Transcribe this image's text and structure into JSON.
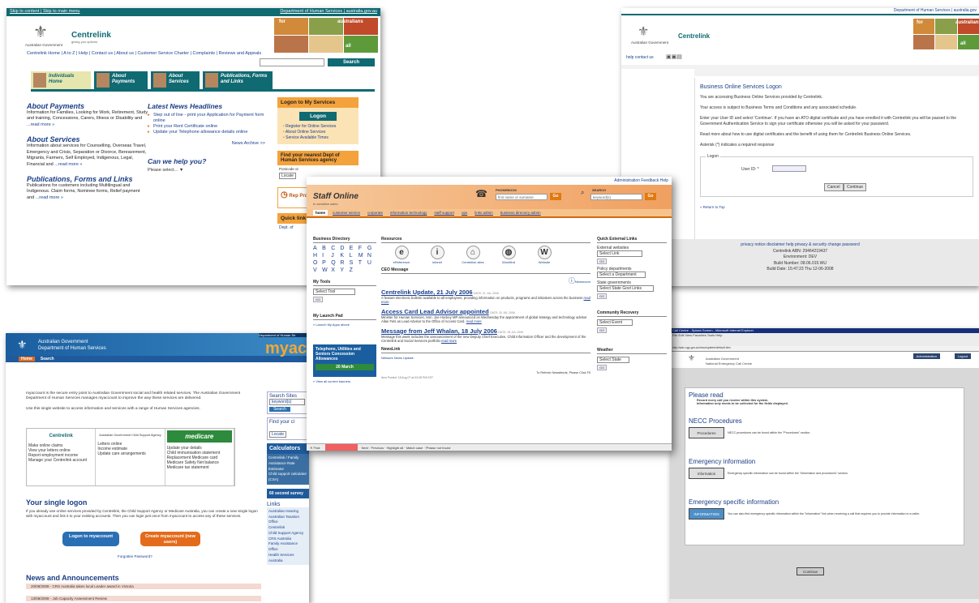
{
  "centrelink_home": {
    "topbar": {
      "skip_content": "Skip to content",
      "skip_menu": "Skip to main menu",
      "dhs": "Department of Human Services",
      "gov_url": "australia.gov.au"
    },
    "brand": {
      "gov": "Australian Government",
      "name": "Centrelink",
      "tag": "giving you options"
    },
    "photo": {
      "label": "australians",
      "for": "for",
      "all": "all"
    },
    "nav_links": "Centrelink Home | A to Z | Help | Contact us | About us | Customer Service Charter | Complaints | Reviews and Appeals",
    "search_button": "Search",
    "tabs": [
      {
        "label": "Individuals Home"
      },
      {
        "label": "About Payments"
      },
      {
        "label": "About Services"
      },
      {
        "label": "Publications, Forms and Links"
      }
    ],
    "about_payments": {
      "title": "About Payments",
      "body": "Information for Families, Looking for Work, Retirement, Study and training, Concessions, Carers, Illness or Disability and",
      "more": "...read more »"
    },
    "about_services": {
      "title": "About Services",
      "body": "Information about services for Counselling, Overseas Travel, Emergency and Crisis, Separation or Divorce, Bereavement, Migrants, Farmers, Self Employed, Indigenous, Legal, Financial and",
      "more": "...read more »"
    },
    "publications": {
      "title": "Publications, Forms and Links",
      "body": "Publications for customers including Multilingual and Indigenous. Claim forms, Nominee forms, Relief payment and",
      "more": "...read more »"
    },
    "news": {
      "title": "Latest News Headlines",
      "items": [
        "Step out of line - print your Application for Payment form online",
        "Print your Rent Certificate online",
        "Update your Telephone allowance details online"
      ],
      "archive": "News Archive >>"
    },
    "help": {
      "title": "Can we help you?",
      "select": "Please select... ▼"
    },
    "logon": {
      "title": "Logon to My Services",
      "button": "Logon",
      "links": [
        "Register for Online Services",
        "About Online Services",
        "Service Available Times"
      ]
    },
    "find": {
      "title": "Find your nearest Dept of Human Services agency",
      "postcode": "Postcode or",
      "locate": "Locate"
    },
    "rep": {
      "text": "Rep Pro"
    },
    "quick": {
      "title": "Quick link",
      "item": "Dept. of"
    }
  },
  "bos_logon": {
    "top_links": "Department of Human Services | australia.gov",
    "brand": {
      "gov": "Australian Government",
      "name": "Centrelink"
    },
    "photo": {
      "for": "for",
      "label": "australians",
      "all": "all"
    },
    "subnav": "help  contact us",
    "title": "Business Online Services Logon",
    "p1": "You are accessing Business Online Services provided by Centrelink.",
    "p2": "Your access is subject to Business Terms and Conditions and any associated schedule.",
    "p3": "Enter your User ID and select 'Continue'. If you have an ATO digital certificate and you have enrolled it with Centrelink you will be passed to the Government Authentication Service to sign your certificate otherwise you will be asked for your password.",
    "p4": "Read more about how to use digital certificates and the benefit of using them for Centrelink Business Online Services.",
    "p5": "Asterisk (*) indicates a required response",
    "legend": "Logon",
    "user_label": "User ID: *",
    "cancel": "Cancel",
    "continue": "Continue",
    "return": "» Return to Top",
    "footer_links": "privacy notice   disclaimer   help   privacy & security   change password",
    "abn": "Centrelink ABN: 29464219437",
    "env": "Environment: DEV",
    "build_num": "Build Number: 08.06.015.WU",
    "build_date": "Build Date: 15:47:23 Thu 12-06-2008"
  },
  "myaccount": {
    "strip": "Department of Human Se",
    "gov1": "Australian Government",
    "gov2": "Department of Human Services",
    "brand": "myac",
    "nav": [
      "Home",
      "Search"
    ],
    "intro1": "myaccount is the secure entry point to Australian Government social and health related services. The Australian Government Department of Human Services manages myaccount to improve the way these services are delivered.",
    "intro2": "Use this single website to access information and services with a range of Human Services agencies.",
    "cols": [
      {
        "logo": "Centrelink",
        "items": [
          "Make online claims",
          "View your letters online",
          "Report employment income",
          "Manage your Centrelink account"
        ]
      },
      {
        "logo": "Australian Government Child Support Agency",
        "items": [
          "Letters online",
          "Income estimate",
          "Update care arrangements"
        ]
      },
      {
        "logo": "medicare",
        "items": [
          "Update your details",
          "Child immunisation statement",
          "Replacement Medicare card",
          "Medicare Safety Net balance",
          "Medicare tax statement"
        ]
      }
    ],
    "single_title": "Your single logon",
    "single_body": "If you already use online services provided by Centrelink, the Child Support Agency or Medicare Australia, you can create a new single logon with myaccount and link it to your existing accounts. Then you can login just once from myaccount to access any of these services.",
    "login_btn": "Logon to myaccount",
    "create_btn": "Create myaccount (new users)",
    "forgot": "Forgotten Password?",
    "news_title": "News and Announcements",
    "news": [
      "20/08/2008 - CRS Australia takes local Leader award in Victoria",
      "13/08/2008 - Job Capacity Assessment Review"
    ],
    "search_sites": "Search Sites",
    "keywords": "keyword(s)",
    "search_btn": "Search",
    "find": "Find your cl",
    "locate": "Locate",
    "calc_title": "Calculators",
    "calc_items": [
      "Centrelink / Family Assistance Rate Estimator",
      "Child support calculator (CSA)"
    ],
    "survey": "60 second survey",
    "links_title": "Links",
    "links": [
      "Australian Hearing",
      "Australian Taxation Office",
      "Centrelink",
      "Child Support Agency",
      "CRS Australia",
      "Family Assistance Office",
      "Health Services Australia"
    ]
  },
  "staff_online": {
    "toplinks": "Administration  Feedback  Help",
    "title": "Staff Online",
    "sub": "In sensitive sales",
    "phonebook": "PHONEBOOK",
    "phone_ph": "first name or surname",
    "search_lbl": "SEARCH",
    "search_ph": "keyword(s)",
    "go": "Go",
    "menu": [
      "home",
      "customer service",
      "corporate",
      "information technology",
      "staff support",
      "ops",
      "links admin",
      "business directory admin"
    ],
    "bizdir": "Business Directory",
    "letters": [
      "A",
      "B",
      "C",
      "D",
      "E",
      "F",
      "G",
      "H",
      "I",
      "J",
      "K",
      "L",
      "M",
      "N",
      "O",
      "P",
      "Q",
      "R",
      "S",
      "T",
      "U",
      "V",
      "W",
      "X",
      "Y",
      "Z"
    ],
    "mytools": "My Tools",
    "select_tool": "Select Tool",
    "go_small": "GO",
    "launchpad": "My Launch Pad",
    "launch_link": "» Launch My Apps above",
    "promo": "Telephone, Utilities and Seniors Concession Allowances",
    "promo_date": "20 March",
    "view_banners": "» View all current banners",
    "resources": "Resources",
    "icons": [
      "eReference",
      "infonet",
      "Centrelink sites",
      "Wordfind",
      "Website"
    ],
    "ceo": "CEO Message",
    "newsroom": "Newsroom",
    "news": [
      {
        "title": "Centrelink Update, 21 July 2006",
        "date": "DATE: 21 JUL 2006",
        "body": "A feature electronic bulletin available to all employees, providing information on products, programs and initiatives across the business",
        "more": "read more"
      },
      {
        "title": "Access Card Lead Advisor appointed",
        "date": "DATE: 20 JUL 2006",
        "body": "Minister for Human Services, Hon. Joe Hockey MP announced on Wednesday the appointment of global strategy and technology advisor Allan Fels as Lead Advisor to the Office of Access Card.",
        "more": "read more"
      },
      {
        "title": "Message from Jeff Whalan, 18 July 2006",
        "date": "DATE: 18 JUL 2006",
        "body": "Message this week includes the announcement of the new Deputy Chief Executive, Child Information Officer and the development of the Centrelink and Social Services portfolio",
        "more": "read more"
      }
    ],
    "newslink": "NewsLink",
    "network_news": "Network News Update",
    "ext_title": "Quick External Links",
    "ext_websites": "External websites",
    "ext_select": "Select Link",
    "policy": "Policy departments",
    "policy_select": "Select a Department",
    "state": "State governments",
    "state_select": "Select State Govt Links",
    "recovery": "Community Recovery",
    "recovery_select": "Select Event",
    "weather": "Weather",
    "weather_select": "Select State",
    "refresh": "To Refresh Newsfeeds, Please Click F5",
    "posted": "Item Posted: 18 Aug 07 at 03:28 PM EST",
    "find": {
      "label": "Find:",
      "next": "Next",
      "prev": "Previous",
      "highlight": "Highlight all",
      "match": "Match case",
      "notfound": "Phrase not found"
    }
  },
  "necc": {
    "titlebar": "Call Centre - Splash Screen - Microsoft Internet Explorer",
    "menubar": "File  Edit  View  Favorites  Tools  Help",
    "address": "http://wdc.cgp.gov.au/necc/system/default.htm",
    "gov": "Australian Government",
    "centre": "National Emergency Call Centre",
    "admin": "Administration",
    "logout": "Logout",
    "read_title": "Please read",
    "read_items": [
      "Record every call you receive within this system.",
      "Information only needs to be collected for the fields displayed."
    ],
    "sections": [
      {
        "title": "NECC Procedures",
        "btn": "Procedures",
        "text": "NECC procedures can be found within the \"Procedures\" section."
      },
      {
        "title": "Emergency information",
        "btn": "Information",
        "text": "Emergency specific information can be found within the \"Information and procedures\" section."
      },
      {
        "title": "Emergency specific information",
        "btn": "INFORMATION",
        "text": "You can also find emergency specific information within the \"Information\" link when receiving a call that requires you to provide information to a caller."
      }
    ],
    "continue": "Continue"
  }
}
